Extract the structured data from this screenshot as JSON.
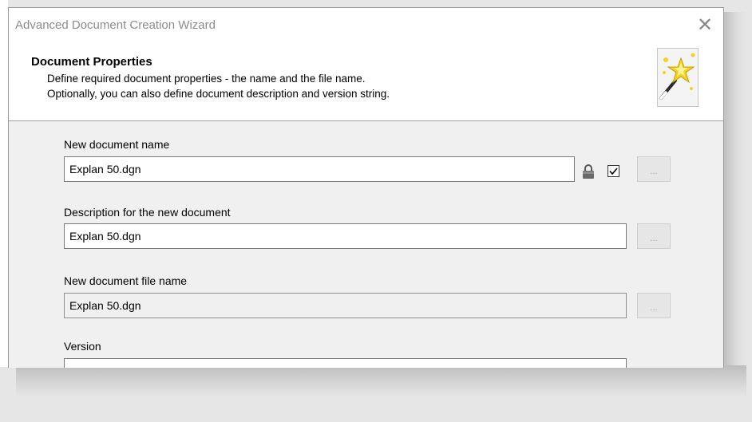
{
  "window": {
    "title": "Advanced Document Creation Wizard",
    "close_glyph": "✕"
  },
  "header": {
    "title": "Document Properties",
    "line1": "Define required document properties - the name and the file name.",
    "line2": "Optionally, you can also define document description and version string.",
    "icon": "wizard-wand-icon"
  },
  "fields": {
    "name": {
      "label": "New document name",
      "value": "Explan 50.dgn",
      "locked": true,
      "checked": true
    },
    "description": {
      "label": "Description for the new document",
      "value": "Explan 50.dgn"
    },
    "file_name": {
      "label": "New document file name",
      "value": "Explan 50.dgn",
      "readonly": true
    },
    "version": {
      "label": "Version",
      "value": ""
    }
  },
  "browse_label": "..."
}
